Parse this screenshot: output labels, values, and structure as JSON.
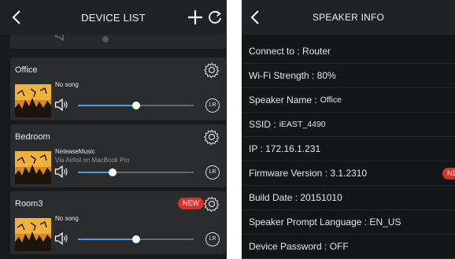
{
  "device_list": {
    "header": {
      "title": "DEVICE LIST"
    },
    "devices": [
      {
        "name": "Office",
        "song": "No song",
        "source": "",
        "volume_percent": 50,
        "new": false,
        "lr_label": "LR"
      },
      {
        "name": "Bedroom",
        "song": "NeteaseMusic",
        "source": "Via Airfoil on MacBook Pro",
        "volume_percent": 30,
        "new": false,
        "lr_label": "LR"
      },
      {
        "name": "Room3",
        "song": "No song",
        "source": "",
        "volume_percent": 50,
        "new": true,
        "new_label": "NEW",
        "lr_label": "LR"
      }
    ]
  },
  "speaker_info": {
    "header": {
      "title": "SPEAKER INFO"
    },
    "rows": {
      "connect_to": "Connect to : Router",
      "wifi_strength": "Wi-Fi Strength : 80%",
      "speaker_name_label": "Speaker Name : ",
      "speaker_name_value": "Office",
      "ssid_label": "SSID : ",
      "ssid_value": "iEAST_4490",
      "ip": "IP : 172.16.1.231",
      "firmware": "Firmware Version : 3.1.2310",
      "firmware_badge": "NEW",
      "build_date": "Build Date : 20151010",
      "prompt_language": "Speaker Prompt Language : EN_US",
      "device_password": "Device Password : OFF"
    }
  },
  "colors": {
    "accent": "#4b9fe0",
    "badge": "#d9312e",
    "background": "#181a1c",
    "card": "#2a2c2e"
  }
}
